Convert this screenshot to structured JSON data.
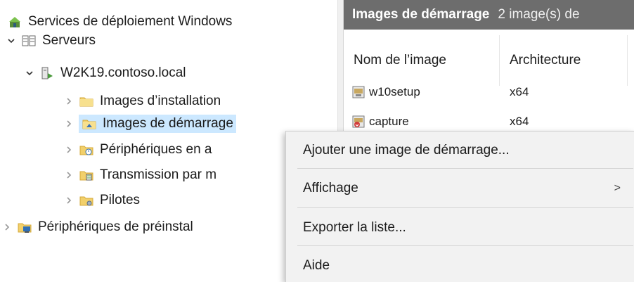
{
  "tree": {
    "root": "Services de déploiement Windows",
    "servers": "Serveurs",
    "server": "W2K19.contoso.local",
    "install_images": "Images d’installation",
    "boot_images": "Images de démarrage",
    "pending_devices": "Périphériques en a",
    "multicast": "Transmission par m",
    "drivers": "Pilotes",
    "prestaged": "Périphériques de préinstal"
  },
  "result": {
    "title": "Images de démarrage",
    "count": "2 image(s) de",
    "columns": [
      "Nom de l’image",
      "Architecture"
    ],
    "rows": [
      {
        "name": "w10setup",
        "arch": "x64"
      },
      {
        "name": "capture",
        "arch": "x64"
      }
    ]
  },
  "context_menu": {
    "items": [
      "Ajouter une image de démarrage...",
      "Affichage",
      "Exporter la liste...",
      "Aide"
    ],
    "submenu_arrow": ">"
  },
  "colors": {
    "selection": "#cce8ff",
    "header_bar": "#6d6d6d",
    "menu_bg": "#f2f2f2"
  }
}
